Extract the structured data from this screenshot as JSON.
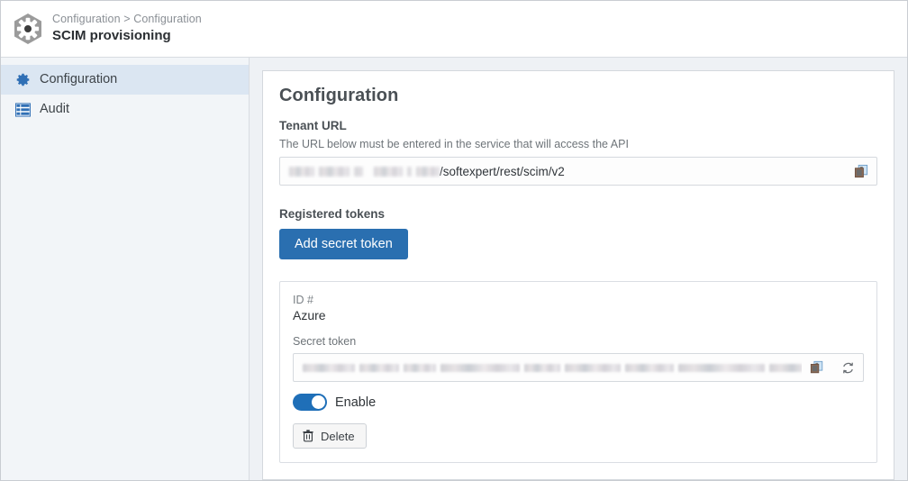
{
  "header": {
    "app_icon": "hexagon-gear-icon",
    "breadcrumb": "Configuration > Configuration",
    "page_title": "SCIM provisioning"
  },
  "sidebar": {
    "items": [
      {
        "label": "Configuration",
        "icon": "gear-icon",
        "active": true
      },
      {
        "label": "Audit",
        "icon": "table-grid-icon",
        "active": false
      }
    ]
  },
  "main": {
    "section_title": "Configuration",
    "tenant_url": {
      "label": "Tenant URL",
      "hint": "The URL below must be entered in the service that will access the API",
      "value_masked_prefix": "[redacted host]",
      "value_suffix": "/softexpert/rest/scim/v2",
      "copy_icon": "copy-icon"
    },
    "registered_tokens": {
      "label": "Registered tokens",
      "add_button_label": "Add secret token",
      "token_card": {
        "id_label": "ID #",
        "id_value": "Azure",
        "secret_label": "Secret token",
        "secret_value_masked": "[redacted secret token]",
        "copy_icon": "copy-icon",
        "refresh_icon": "refresh-icon",
        "toggle_label": "Enable",
        "toggle_on": true,
        "delete_label": "Delete",
        "delete_icon": "trash-icon"
      }
    }
  },
  "colors": {
    "accent_blue": "#2a6fb0",
    "toggle_blue": "#1f6fb8",
    "sidebar_bg": "#f2f5f8",
    "sidebar_active": "#dbe6f2",
    "page_bg": "#eef1f5",
    "panel_bg": "#ffffff",
    "icon_blue": "#2f6fb5"
  }
}
